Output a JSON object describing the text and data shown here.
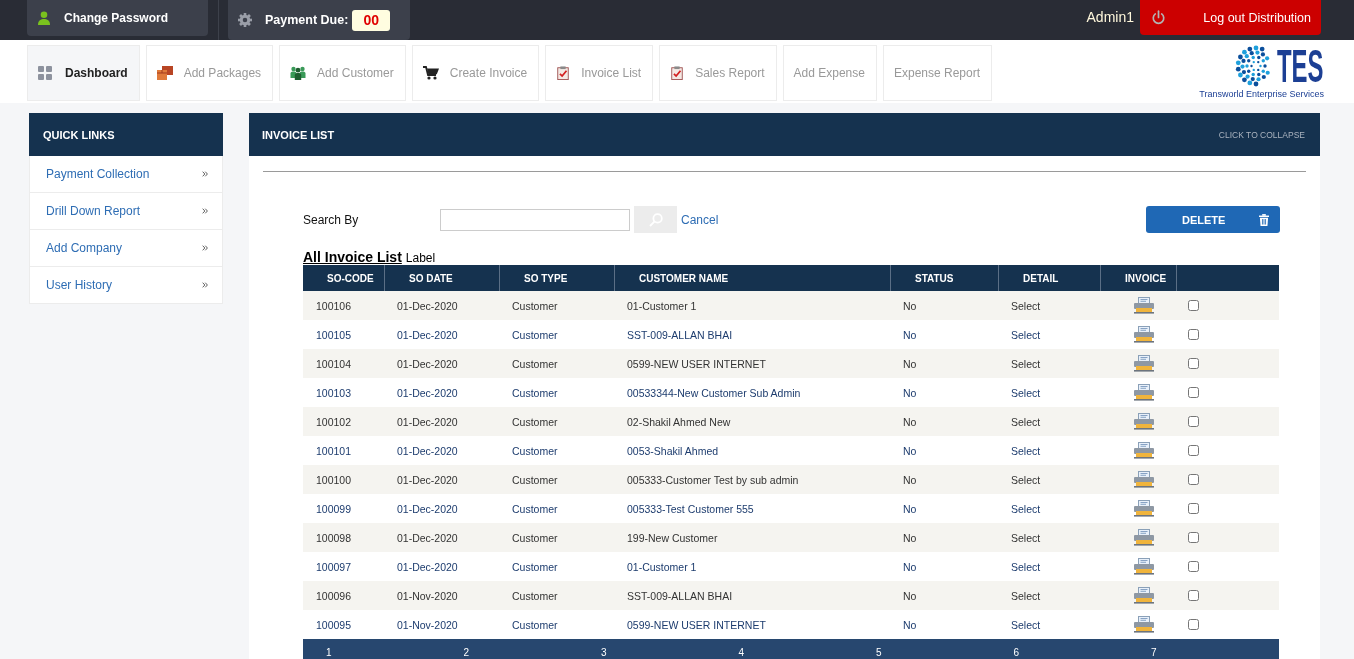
{
  "top_bar": {
    "change_password": "Change Password",
    "payment_due": {
      "label": "Payment Due:",
      "value": "00"
    },
    "user": "Admin1",
    "logout": "Log out Distribution"
  },
  "nav_tabs": [
    {
      "label": "Dashboard",
      "kind": "grid",
      "selected": true
    },
    {
      "label": "Add Packages",
      "kind": "boxes",
      "selected": false
    },
    {
      "label": "Add Customer",
      "kind": "people",
      "selected": false
    },
    {
      "label": "Create Invoice",
      "kind": "cart",
      "selected": false
    },
    {
      "label": "Invoice List",
      "kind": "clipboard",
      "selected": false
    },
    {
      "label": "Sales Report",
      "kind": "clipboard",
      "selected": false
    },
    {
      "label": "Add Expense",
      "kind": "plain",
      "selected": false
    },
    {
      "label": "Expense Report",
      "kind": "plain",
      "selected": false
    }
  ],
  "logo": {
    "title": "TES",
    "tagline": "Transworld Enterprise Services"
  },
  "quick_links": {
    "title": "QUICK LINKS",
    "items": [
      "Payment Collection",
      "Drill Down Report",
      "Add Company",
      "User History"
    ]
  },
  "invoice_list": {
    "title": "INVOICE LIST",
    "collapse": "CLICK TO COLLAPSE",
    "search": {
      "label": "Search By",
      "cancel": "Cancel"
    },
    "delete": "DELETE",
    "list_title": "All Invoice List",
    "list_label": "Label",
    "table": {
      "columns": [
        "SO-CODE",
        "SO DATE",
        "SO TYPE",
        "CUSTOMER NAME",
        "STATUS",
        "DETAIL",
        "INVOICE"
      ],
      "rows": [
        {
          "so_code": "100106",
          "so_date": "01-Dec-2020",
          "so_type": "Customer",
          "customer": "01-Customer 1",
          "status": "No",
          "detail": "Select",
          "checked": false
        },
        {
          "so_code": "100105",
          "so_date": "01-Dec-2020",
          "so_type": "Customer",
          "customer": "SST-009-ALLAN BHAI",
          "status": "No",
          "detail": "Select",
          "checked": false
        },
        {
          "so_code": "100104",
          "so_date": "01-Dec-2020",
          "so_type": "Customer",
          "customer": "0599-NEW USER INTERNET",
          "status": "No",
          "detail": "Select",
          "checked": false
        },
        {
          "so_code": "100103",
          "so_date": "01-Dec-2020",
          "so_type": "Customer",
          "customer": "00533344-New Customer Sub Admin",
          "status": "No",
          "detail": "Select",
          "checked": false
        },
        {
          "so_code": "100102",
          "so_date": "01-Dec-2020",
          "so_type": "Customer",
          "customer": "02-Shakil Ahmed New",
          "status": "No",
          "detail": "Select",
          "checked": false
        },
        {
          "so_code": "100101",
          "so_date": "01-Dec-2020",
          "so_type": "Customer",
          "customer": "0053-Shakil Ahmed",
          "status": "No",
          "detail": "Select",
          "checked": false
        },
        {
          "so_code": "100100",
          "so_date": "01-Dec-2020",
          "so_type": "Customer",
          "customer": "005333-Customer Test by sub admin",
          "status": "No",
          "detail": "Select",
          "checked": false
        },
        {
          "so_code": "100099",
          "so_date": "01-Dec-2020",
          "so_type": "Customer",
          "customer": "005333-Test Customer 555",
          "status": "No",
          "detail": "Select",
          "checked": false
        },
        {
          "so_code": "100098",
          "so_date": "01-Dec-2020",
          "so_type": "Customer",
          "customer": "199-New Customer",
          "status": "No",
          "detail": "Select",
          "checked": false
        },
        {
          "so_code": "100097",
          "so_date": "01-Dec-2020",
          "so_type": "Customer",
          "customer": "01-Customer 1",
          "status": "No",
          "detail": "Select",
          "checked": false
        },
        {
          "so_code": "100096",
          "so_date": "01-Nov-2020",
          "so_type": "Customer",
          "customer": "SST-009-ALLAN BHAI",
          "status": "No",
          "detail": "Select",
          "checked": false
        },
        {
          "so_code": "100095",
          "so_date": "01-Nov-2020",
          "so_type": "Customer",
          "customer": "0599-NEW USER INTERNET",
          "status": "No",
          "detail": "Select",
          "checked": false
        }
      ]
    },
    "pages": [
      "1",
      "2",
      "3",
      "4",
      "5",
      "6",
      "7"
    ]
  }
}
